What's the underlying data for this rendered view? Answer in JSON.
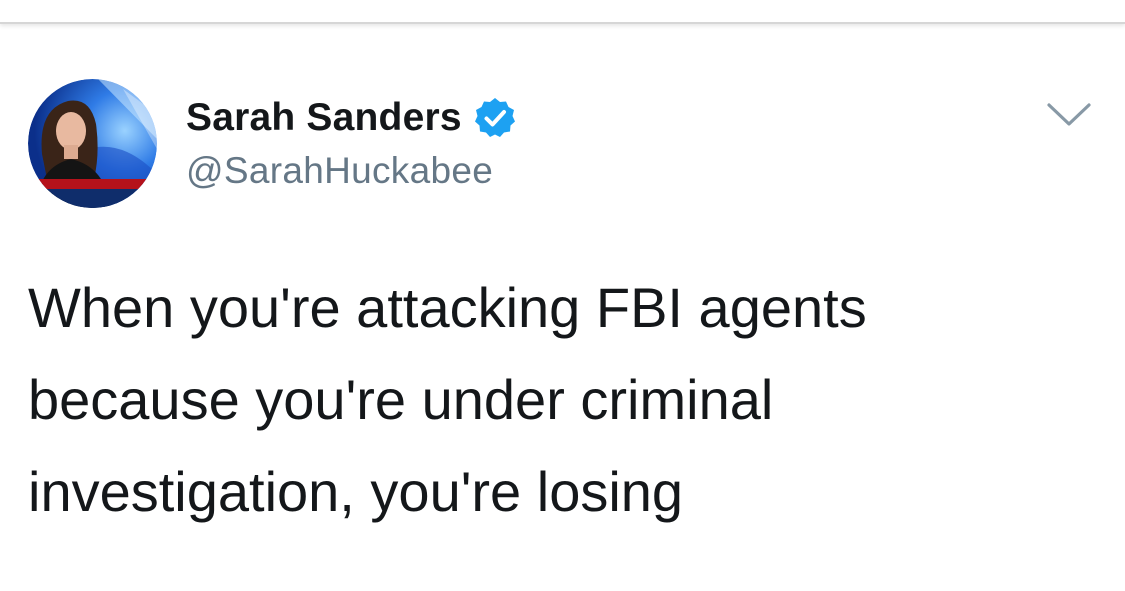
{
  "tweet": {
    "author": {
      "display_name": "Sarah Sanders",
      "handle": "@SarahHuckabee",
      "verified": true,
      "avatar_icon": "profile-photo"
    },
    "text_lines": [
      "When you're attacking FBI agents",
      "because you're under criminal",
      "investigation, you're losing"
    ],
    "menu_icon": "chevron-down-icon"
  },
  "colors": {
    "name": "#14171a",
    "handle": "#657786",
    "verified_badge": "#1da1f2",
    "caret": "#8899a6"
  }
}
